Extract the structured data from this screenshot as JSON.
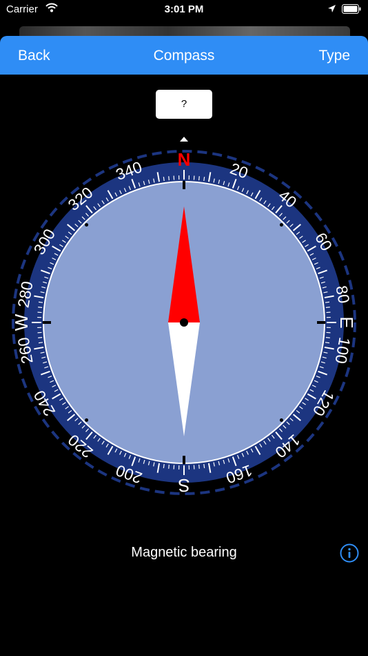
{
  "status_bar": {
    "carrier": "Carrier",
    "time": "3:01 PM"
  },
  "nav": {
    "back_label": "Back",
    "title": "Compass",
    "type_label": "Type"
  },
  "reading": {
    "value": "?"
  },
  "dial": {
    "cardinals": {
      "north": "N",
      "east": "E",
      "south": "S",
      "west": "W"
    },
    "degree_labels": [
      "20",
      "40",
      "60",
      "80",
      "100",
      "120",
      "140",
      "160",
      "200",
      "220",
      "240",
      "260",
      "280",
      "300",
      "320",
      "340"
    ],
    "bezel_color": "#1c3580",
    "face_color": "#8aa0d2",
    "north_color": "#ff0000"
  },
  "footer": {
    "bearing_label": "Magnetic bearing"
  },
  "icons": [
    "wifi-icon",
    "location-arrow-icon",
    "battery-icon",
    "info-icon",
    "needle-icon"
  ]
}
